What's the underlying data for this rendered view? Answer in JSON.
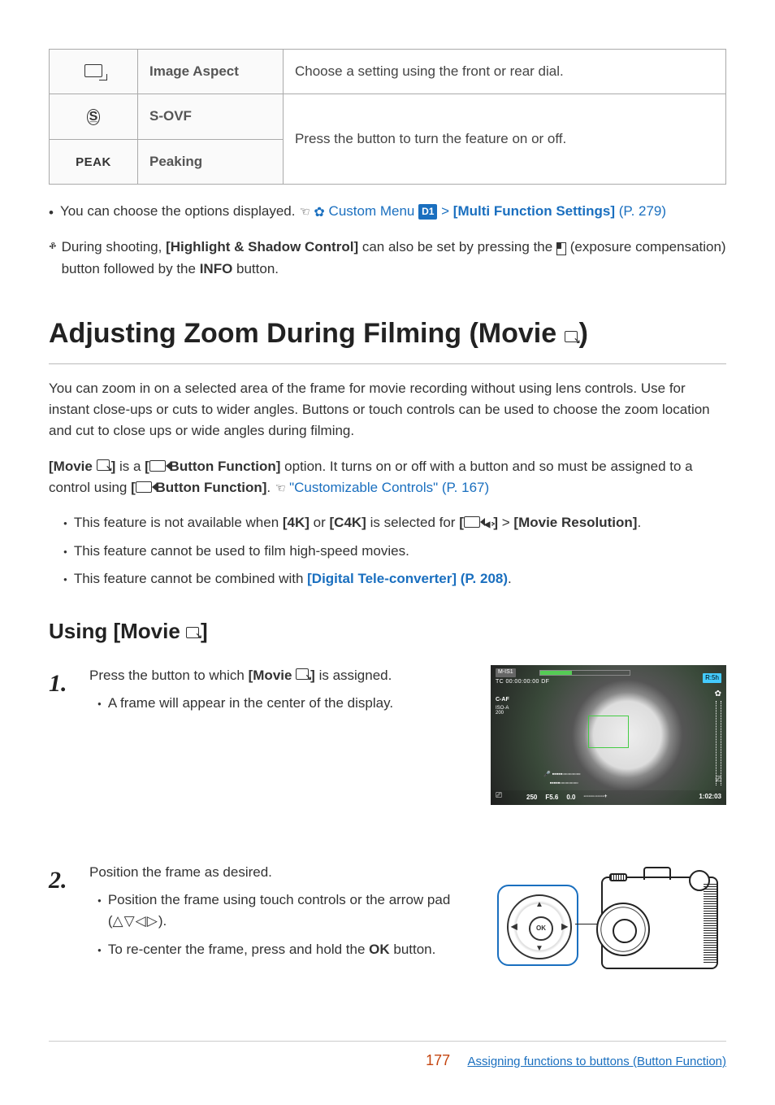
{
  "table": {
    "rows": [
      {
        "icon_name": "aspect-icon",
        "icon_text": "",
        "label": "Image Aspect",
        "desc": "Choose a setting using the front or rear dial."
      },
      {
        "icon_name": "sovf-icon",
        "icon_text": "S-OVF",
        "label": "S-OVF",
        "desc": "Press the button to turn the feature on or off."
      },
      {
        "icon_name": "peak-icon",
        "icon_text": "PEAK",
        "label": "Peaking",
        "desc": ""
      }
    ]
  },
  "note_options": {
    "lead": "You can choose the options displayed.",
    "link1_pre": " Custom Menu ",
    "link1_badge": "D1",
    "link1_sep": " > ",
    "link1_bold": "[Multi Function Settings]",
    "link1_page": " (P. 279)"
  },
  "tip": {
    "pre": "During shooting, ",
    "bold1": "[Highlight & Shadow Control]",
    "mid": " can also be set by pressing the ",
    "icon_label": "exposure compensation",
    "post1": " (exposure compensation) button followed by the ",
    "bold2": "INFO",
    "post2": " button."
  },
  "heading": {
    "pre": "Adjusting Zoom During Filming (Movie ",
    "post": ")"
  },
  "intro": "You can zoom in on a selected area of the frame for movie recording without using lens controls. Use for instant close-ups or cuts to wider angles. Buttons or touch controls can be used to choose the zoom location and cut to close ups or wide angles during filming.",
  "assign_para": {
    "p1a": "[Movie ",
    "p1b": "]",
    "p1c": " is a ",
    "p1d": "[",
    "p1e": " Button Function]",
    "p1f": " option. It turns on or off with a button and so must be assigned to a control using ",
    "p1g": "[",
    "p1h": " Button Function]",
    "p1i": ". ",
    "linktext": "\"Customizable Controls\" (P. 167)"
  },
  "feat_bullets": {
    "b1a": "This feature is not available when ",
    "b1b": "[4K]",
    "b1c": " or ",
    "b1d": "[C4K]",
    "b1e": " is selected for ",
    "b1f": "[",
    "b1g": "]",
    "b1h": " > ",
    "b1i": "[Movie Resolution]",
    "b1j": ".",
    "b2": "This feature cannot be used to film high-speed movies.",
    "b3a": "This feature cannot be combined with ",
    "b3link": "[Digital Tele-converter] (P. 208)",
    "b3b": "."
  },
  "subheading": {
    "pre": "Using [Movie ",
    "post": "]"
  },
  "steps": {
    "s1": {
      "num": "1.",
      "text_a": "Press the button to which ",
      "text_b": "[Movie ",
      "text_c": "]",
      "text_d": " is assigned.",
      "sub": "A frame will appear in the center of the display."
    },
    "s2": {
      "num": "2.",
      "text": "Position the frame as desired.",
      "sub1": "Position the frame using touch controls or the arrow pad (",
      "arrows": "△▽◁▷",
      "sub1b": ").",
      "sub2a": "To re-center the frame, press and hold the ",
      "sub2b": "OK",
      "sub2c": " button."
    }
  },
  "preview": {
    "tc": "TC 00:00:00:00 DF",
    "rec": "M-IS1",
    "caf": "C-AF",
    "iso1": "ISO-A",
    "iso2": "200",
    "badge": "R:5h",
    "shutter": "250",
    "aperture": "F5.6",
    "ev": "0.0",
    "time": "1:02:03"
  },
  "dpad_center": "OK",
  "footer": {
    "page": "177",
    "link": "Assigning functions to buttons (Button Function)"
  }
}
